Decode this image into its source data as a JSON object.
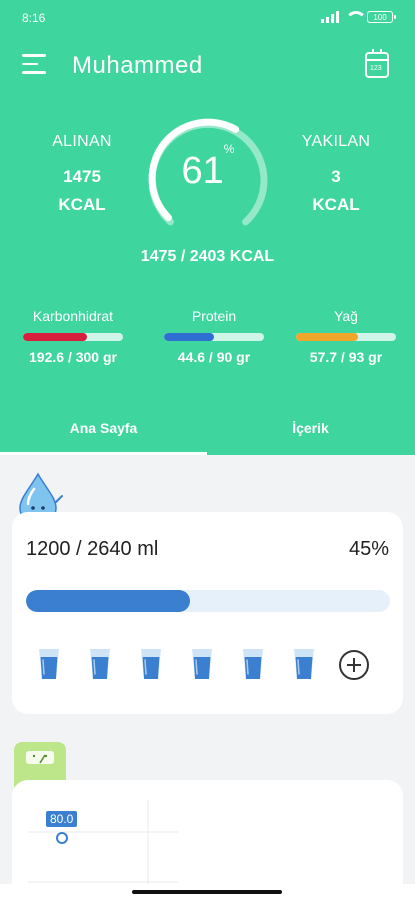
{
  "status_bar": {
    "time": "8:16",
    "battery": "100"
  },
  "header": {
    "username": "Muhammed",
    "calendar_day": "123"
  },
  "calories": {
    "eaten_label": "ALINAN",
    "eaten_value": "1475",
    "eaten_unit": "KCAL",
    "burned_label": "YAKILAN",
    "burned_value": "3",
    "burned_unit": "KCAL",
    "gauge_percent": "61",
    "gauge_percent_symbol": "%",
    "gauge_fraction": 0.61,
    "total": "1475 / 2403 KCAL"
  },
  "macros": [
    {
      "label": "Karbonhidrat",
      "value": "192.6 / 300 gr",
      "fraction": 0.642,
      "color": "#d81e3d"
    },
    {
      "label": "Protein",
      "value": "44.6 / 90 gr",
      "fraction": 0.496,
      "color": "#2f6fd1"
    },
    {
      "label": "Yağ",
      "value": "57.7 / 93 gr",
      "fraction": 0.62,
      "color": "#f0a62a"
    }
  ],
  "tabs": [
    {
      "label": "Ana Sayfa",
      "active": true
    },
    {
      "label": "İçerik",
      "active": false
    }
  ],
  "water": {
    "amount": "1200 / 2640 ml",
    "percent": "45%",
    "fraction": 0.45,
    "glasses": 6
  },
  "weight": {
    "value": "80.0"
  },
  "colors": {
    "primary": "#3fd59e",
    "water": "#3b7fd0"
  }
}
